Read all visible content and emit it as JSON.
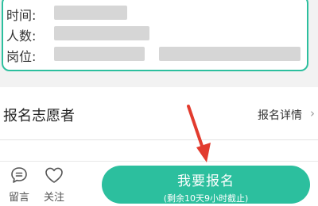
{
  "info": {
    "time_label": "时间:",
    "people_label": "人数:",
    "position_label": "岗位:"
  },
  "volunteers": {
    "title": "报名志愿者",
    "detail_label": "报名详情",
    "chevron": "›"
  },
  "bottom_bar": {
    "comment_label": "留言",
    "follow_label": "关注",
    "signup_label": "我要报名",
    "signup_sub": "(剩余10天9小时截止)"
  },
  "colors": {
    "accent": "#2cbf9e",
    "arrow": "#e23b2e"
  },
  "icons": {
    "comment": "comment-icon",
    "follow": "heart-icon",
    "annotation": "red-arrow"
  }
}
